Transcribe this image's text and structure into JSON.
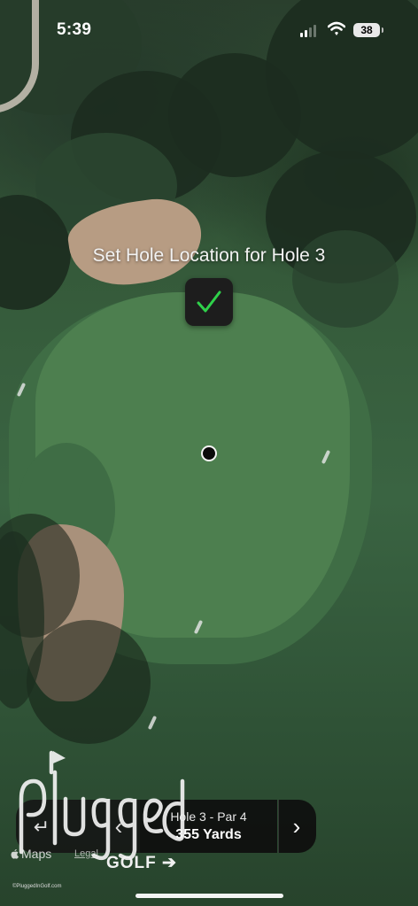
{
  "status_bar": {
    "time": "5:39",
    "battery": "38"
  },
  "screen": {
    "title": "Set Hole Location for Hole 3",
    "confirm_icon": "checkmark-icon",
    "accent_color": "#2fd14a"
  },
  "hole_nav": {
    "back_icon": "return-arrow-icon",
    "prev_icon": "chevron-left-icon",
    "next_icon": "chevron-right-icon",
    "hole_par": "Hole 3 - Par 4",
    "distance": "355 Yards"
  },
  "map_credit": {
    "brand": "Maps",
    "legal": "Legal"
  },
  "watermark": {
    "brand": "Plugged In",
    "sub": "GOLF",
    "copyright": "©PluggedInGolf.com"
  }
}
